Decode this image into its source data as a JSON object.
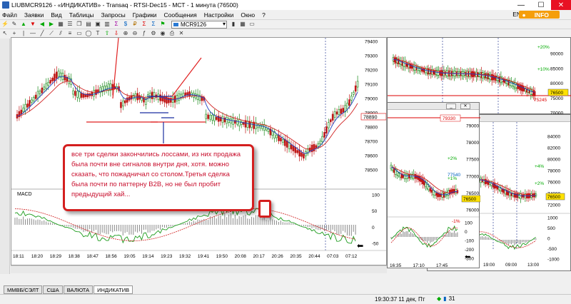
{
  "window": {
    "title": "LIUBMCR9126 - «ИНДИКАТИВ» - Transaq - RTSI-Dec15 - МСТ - 1 минута (76500)"
  },
  "menu": {
    "items": [
      "Файл",
      "Заявки",
      "Вид",
      "Таблицы",
      "Запросы",
      "Графики",
      "Сообщения",
      "Настройки",
      "Окно",
      "?"
    ],
    "lang": "EN",
    "info": "INFO"
  },
  "toolbar": {
    "account": "MCR9126"
  },
  "main_chart": {
    "price_ticks": [
      "79400",
      "79300",
      "79200",
      "79100",
      "79000",
      "78900",
      "78800",
      "78700",
      "78600",
      "78500"
    ],
    "last_price": "78890",
    "macd_label": "MACD",
    "macd_ticks": [
      "100",
      "50",
      "0",
      "-50"
    ],
    "time_ticks": [
      "18:11",
      "18:20",
      "18:29",
      "18:38",
      "18:47",
      "18:56",
      "19:05",
      "19:14",
      "19:23",
      "19:32",
      "19:41",
      "19:50",
      "20:08",
      "20:17",
      "20:26",
      "20:35",
      "20:44",
      "07:03",
      "07:12"
    ]
  },
  "annotation": {
    "text": "все три сделки закончились лоссами, из них продажа была почти вне сигналов внутри дня, хотя. можно сказать, что пожадничал со столом.Третья сделка была почти по паттерну B2B, но не был пробит предыдущий хай..."
  },
  "chart_tr": {
    "ticks": [
      "90000",
      "85000",
      "80000",
      "75000",
      "70000"
    ],
    "tag_price": "76500",
    "tag_level": "75245",
    "pct_up": "+20%",
    "pct_mid": "+10%"
  },
  "chart_mid": {
    "ticks": [
      "79000",
      "78000",
      "77500",
      "77000",
      "76500",
      "76000"
    ],
    "tag_top": "79330",
    "tag_blue": "77540",
    "tag_price": "76500",
    "pct1": "+2%",
    "pct2": "+1%",
    "pct3": "-1%",
    "macd_ticks": [
      "100",
      "0",
      "-100",
      "-200",
      "-300"
    ],
    "time_ticks": [
      "16:35",
      "17:10",
      "17:45"
    ]
  },
  "chart_br": {
    "ticks": [
      "84000",
      "82000",
      "80000",
      "78000",
      "76000",
      "74000",
      "72000"
    ],
    "tag_price": "76500",
    "pct1": "+4%",
    "pct2": "+2%",
    "macd_ticks": [
      "1000",
      "500",
      "0",
      "-500",
      "-1000"
    ],
    "time_ticks": [
      "19:00",
      "09:00",
      "13:00"
    ]
  },
  "tabs": [
    "ММВБ/СЭЛТ",
    "США",
    "ВАЛЮТА",
    "ИНДИКАТИВ"
  ],
  "status": {
    "clock": "19:30:37 11 дек, Пт",
    "count": "31"
  }
}
